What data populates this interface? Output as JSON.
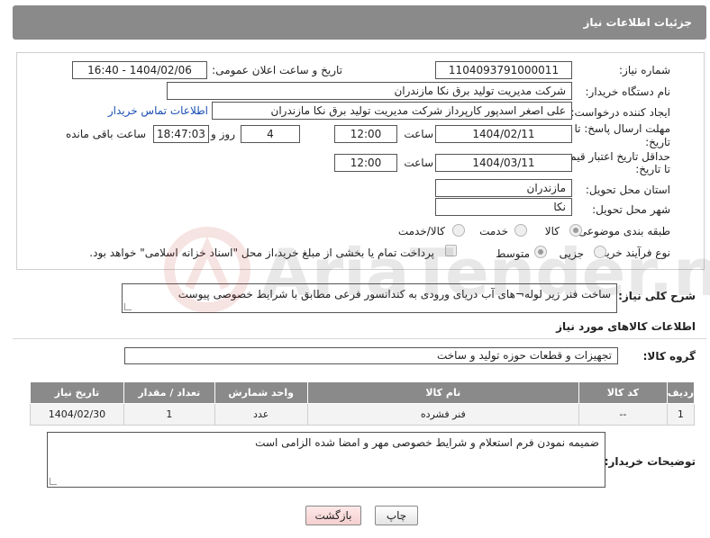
{
  "header": {
    "title": "جزئیات اطلاعات نیاز"
  },
  "form": {
    "need_number_label": "شماره نیاز:",
    "need_number_value": "1104093791000011",
    "announce_label": "تاریخ و ساعت اعلان عمومی:",
    "announce_value": "1404/02/06 - 16:40",
    "buyer_org_label": "نام دستگاه خریدار:",
    "buyer_org_value": "شرکت مدیریت تولید برق نکا  مازندران",
    "creator_label": "ایجاد کننده درخواست:",
    "creator_value": "علی اصغر اسدپور کارپرداز شرکت مدیریت تولید برق نکا  مازندران",
    "contact_link": "اطلاعات تماس خریدار",
    "reply_deadline_label_1": "مهلت ارسال پاسخ: تا",
    "reply_deadline_label_2": "تاریخ:",
    "reply_date": "1404/02/11",
    "time_label": "ساعت",
    "reply_time": "12:00",
    "days_value": "4",
    "days_label": "روز و",
    "remaining_time": "18:47:03",
    "remaining_label": "ساعت باقی مانده",
    "price_validity_label_1": "حداقل تاریخ اعتبار قیمت:",
    "price_validity_label_2": "تا تاریخ:",
    "price_date": "1404/03/11",
    "price_time": "12:00",
    "province_label": "استان محل تحویل:",
    "province_value": "مازندران",
    "city_label": "شهر محل تحویل:",
    "city_value": "نکا",
    "category_label": "طبقه بندی موضوعی:",
    "category_options": [
      "کالا",
      "خدمت",
      "کالا/خدمت"
    ],
    "process_label": "نوع فرآیند خرید :",
    "process_options": [
      "جزیی",
      "متوسط"
    ],
    "payment_note": "پرداخت تمام یا بخشی از مبلغ خرید،از محل \"اسناد خزانه اسلامی\" خواهد بود."
  },
  "description": {
    "label": "شرح کلی نیاز:",
    "value": "ساخت فنر زیر لوله¬های آب دریای ورودی به کندانسور فرعی مطابق با شرایط خصوصی پیوست"
  },
  "goods_section": {
    "title": "اطلاعات کالاهای مورد نیاز",
    "group_label": "گروه کالا:",
    "group_value": "تجهیزات و قطعات حوزه تولید و ساخت",
    "columns": [
      "ردیف",
      "کد کالا",
      "نام کالا",
      "واحد شمارش",
      "تعداد / مقدار",
      "تاریخ نیاز"
    ],
    "rows": [
      [
        "1",
        "--",
        "فنر فشرده",
        "عدد",
        "1",
        "1404/02/30"
      ]
    ]
  },
  "buyer_notes": {
    "label": "توضیحات خریدار:",
    "value": "ضمیمه نمودن فرم استعلام و شرایط خصوصی مهر و امضا شده الزامی است"
  },
  "buttons": {
    "print": "چاپ",
    "back": "بازگشت"
  },
  "watermark": {
    "text": "AriaTender.net"
  },
  "colors": {
    "header": "#8a8a8a",
    "link": "#1a4fb5",
    "back_button": "#f5cfcf"
  }
}
